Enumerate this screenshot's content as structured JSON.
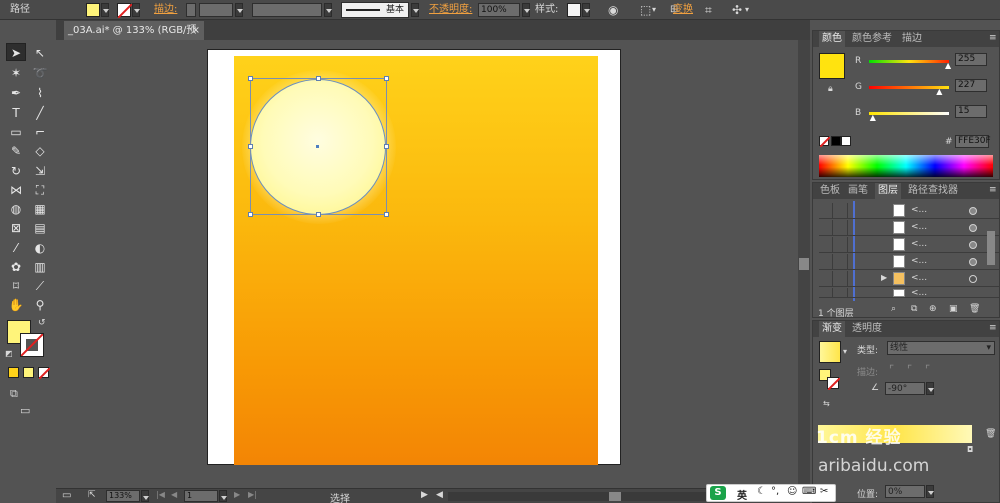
{
  "control_bar": {
    "object_type": "路径",
    "stroke_label": "描边:",
    "stroke_style_label": "基本",
    "opacity_label": "不透明度:",
    "opacity_value": "100%",
    "style_label": "样式:",
    "transform_label": "变换"
  },
  "document": {
    "tab_title": "_03A.ai* @ 133% (RGB/预览)"
  },
  "status_bar": {
    "zoom": "133%",
    "artboard_number": "1",
    "tool_label": "选择"
  },
  "color_panel": {
    "tabs": [
      "颜色",
      "颜色参考",
      "描边"
    ],
    "r_label": "R",
    "g_label": "G",
    "b_label": "B",
    "r_value": "255",
    "g_value": "227",
    "b_value": "15",
    "r_fraction": 1.0,
    "g_fraction": 0.89,
    "b_fraction": 0.06,
    "hex_label": "#",
    "hex_value": "FFE30F",
    "current_color": "#FFE30F"
  },
  "layers_panel": {
    "tabs": [
      "色板",
      "画笔",
      "图层",
      "路径查找器"
    ],
    "rows": [
      "<...",
      "<...",
      "<...",
      "<...",
      "<...",
      "<..."
    ],
    "layer_count": "1 个图层"
  },
  "gradient_panel": {
    "tabs": [
      "渐变",
      "透明度"
    ],
    "type_label": "类型:",
    "type_value": "线性",
    "stroke_label": "描边:",
    "angle_value": "-90°",
    "location_label": "位置:",
    "location_value": "0%"
  },
  "watermark": {
    "line1": "1cm 经验",
    "line2": "aribaidu.com"
  },
  "ime": {
    "label": "英"
  }
}
